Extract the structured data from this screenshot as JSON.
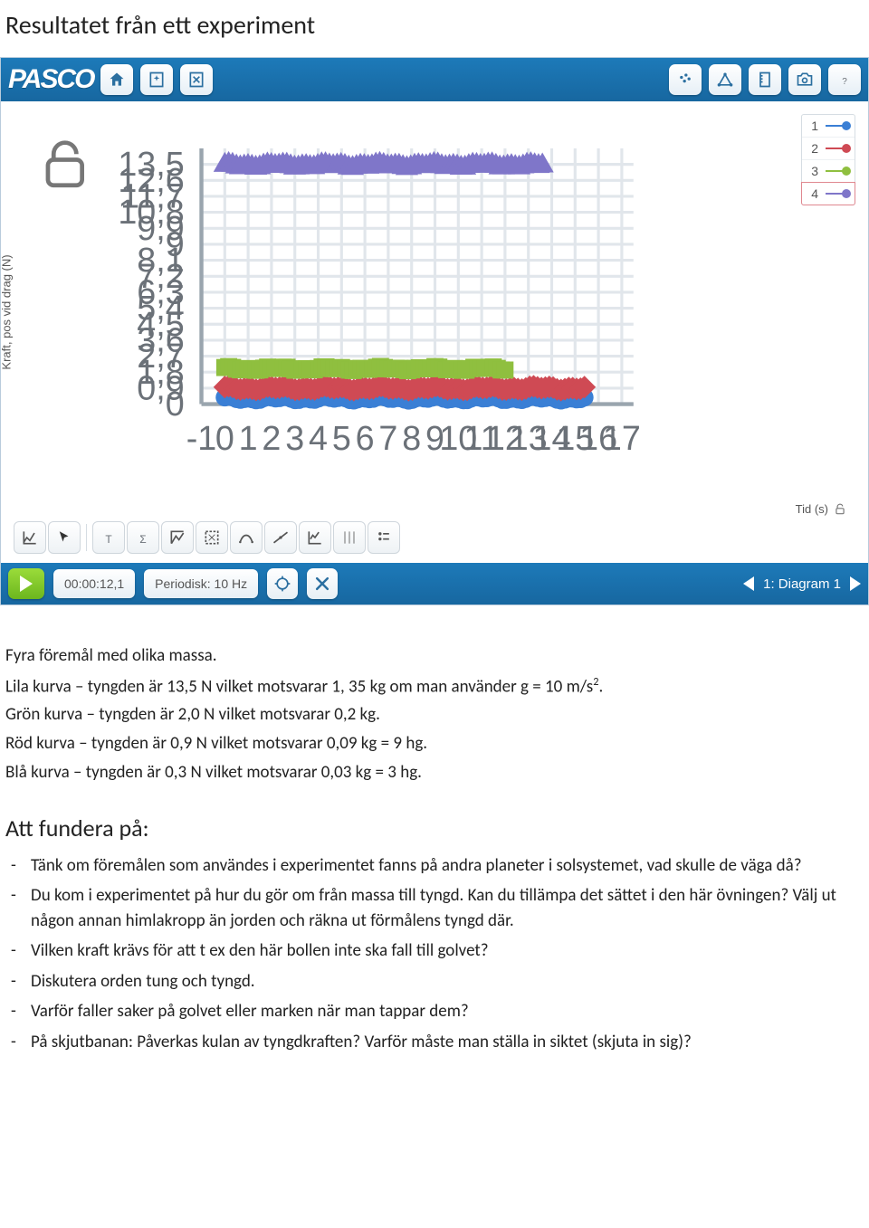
{
  "doc": {
    "heading": "Resultatet från ett experiment",
    "intro": [
      "Fyra föremål med olika massa.",
      "Lila kurva – tyngden är 13,5 N vilket motsvarar 1, 35 kg om man använder g = 10 m/s².",
      "Grön kurva – tyngden är 2,0 N vilket motsvarar 0,2 kg.",
      "Röd kurva – tyngden är 0,9 N vilket motsvarar 0,09 kg = 9 hg.",
      "Blå kurva – tyngden är 0,3 N vilket motsvarar 0,03 kg = 3 hg."
    ],
    "think_heading": "Att fundera på:",
    "questions": [
      "Tänk om föremålen som användes i experimentet fanns på andra planeter i solsystemet, vad skulle de väga då?",
      "Du kom i experimentet på hur du gör om från massa till tyngd. Kan du tillämpa det sättet i den här övningen? Välj ut någon annan himlakropp än jorden och räkna ut förmålens tyngd där.",
      "Vilken kraft krävs för att t ex den här bollen inte ska fall till golvet?",
      "Diskutera orden tung och tyngd.",
      "Varför faller saker på golvet eller marken när man tappar dem?",
      "På skjutbanan: Påverkas kulan av tyngdkraften? Varför måste man ställa in siktet (skjuta in sig)?"
    ]
  },
  "app": {
    "logo": "PASCO",
    "bottom": {
      "time": "00:00:12,1",
      "sample": "Periodisk: 10 Hz",
      "view": "1: Diagram 1"
    }
  },
  "chart_data": {
    "type": "line",
    "xlabel": "Tid (s)",
    "ylabel": "Kraft, pos vid drag (N)",
    "x_ticks": [
      -1,
      0,
      1,
      2,
      3,
      4,
      5,
      6,
      7,
      8,
      9,
      10,
      11,
      12,
      13,
      14,
      15,
      16,
      17
    ],
    "y_ticks": [
      0.0,
      0.9,
      1.8,
      2.7,
      3.6,
      4.5,
      5.4,
      6.3,
      7.2,
      8.1,
      9.0,
      9.9,
      10.8,
      11.7,
      12.6,
      13.5
    ],
    "xlim": [
      -1,
      17.5
    ],
    "ylim": [
      0,
      14.4
    ],
    "series": [
      {
        "name": "1",
        "color": "#3a7fd5",
        "shape": "circle",
        "x_range": [
          0,
          15.4
        ],
        "y": 0.32
      },
      {
        "name": "2",
        "color": "#cf4a54",
        "shape": "diamond",
        "x_range": [
          0,
          15.4
        ],
        "y": 0.9
      },
      {
        "name": "3",
        "color": "#8fbf3f",
        "shape": "square",
        "x_range": [
          0,
          12.0
        ],
        "y": 2.0
      },
      {
        "name": "4",
        "color": "#7f76c9",
        "shape": "triangle",
        "x_range": [
          0,
          13.6
        ],
        "y": 13.5
      }
    ],
    "legend": [
      "1",
      "2",
      "3",
      "4"
    ]
  }
}
